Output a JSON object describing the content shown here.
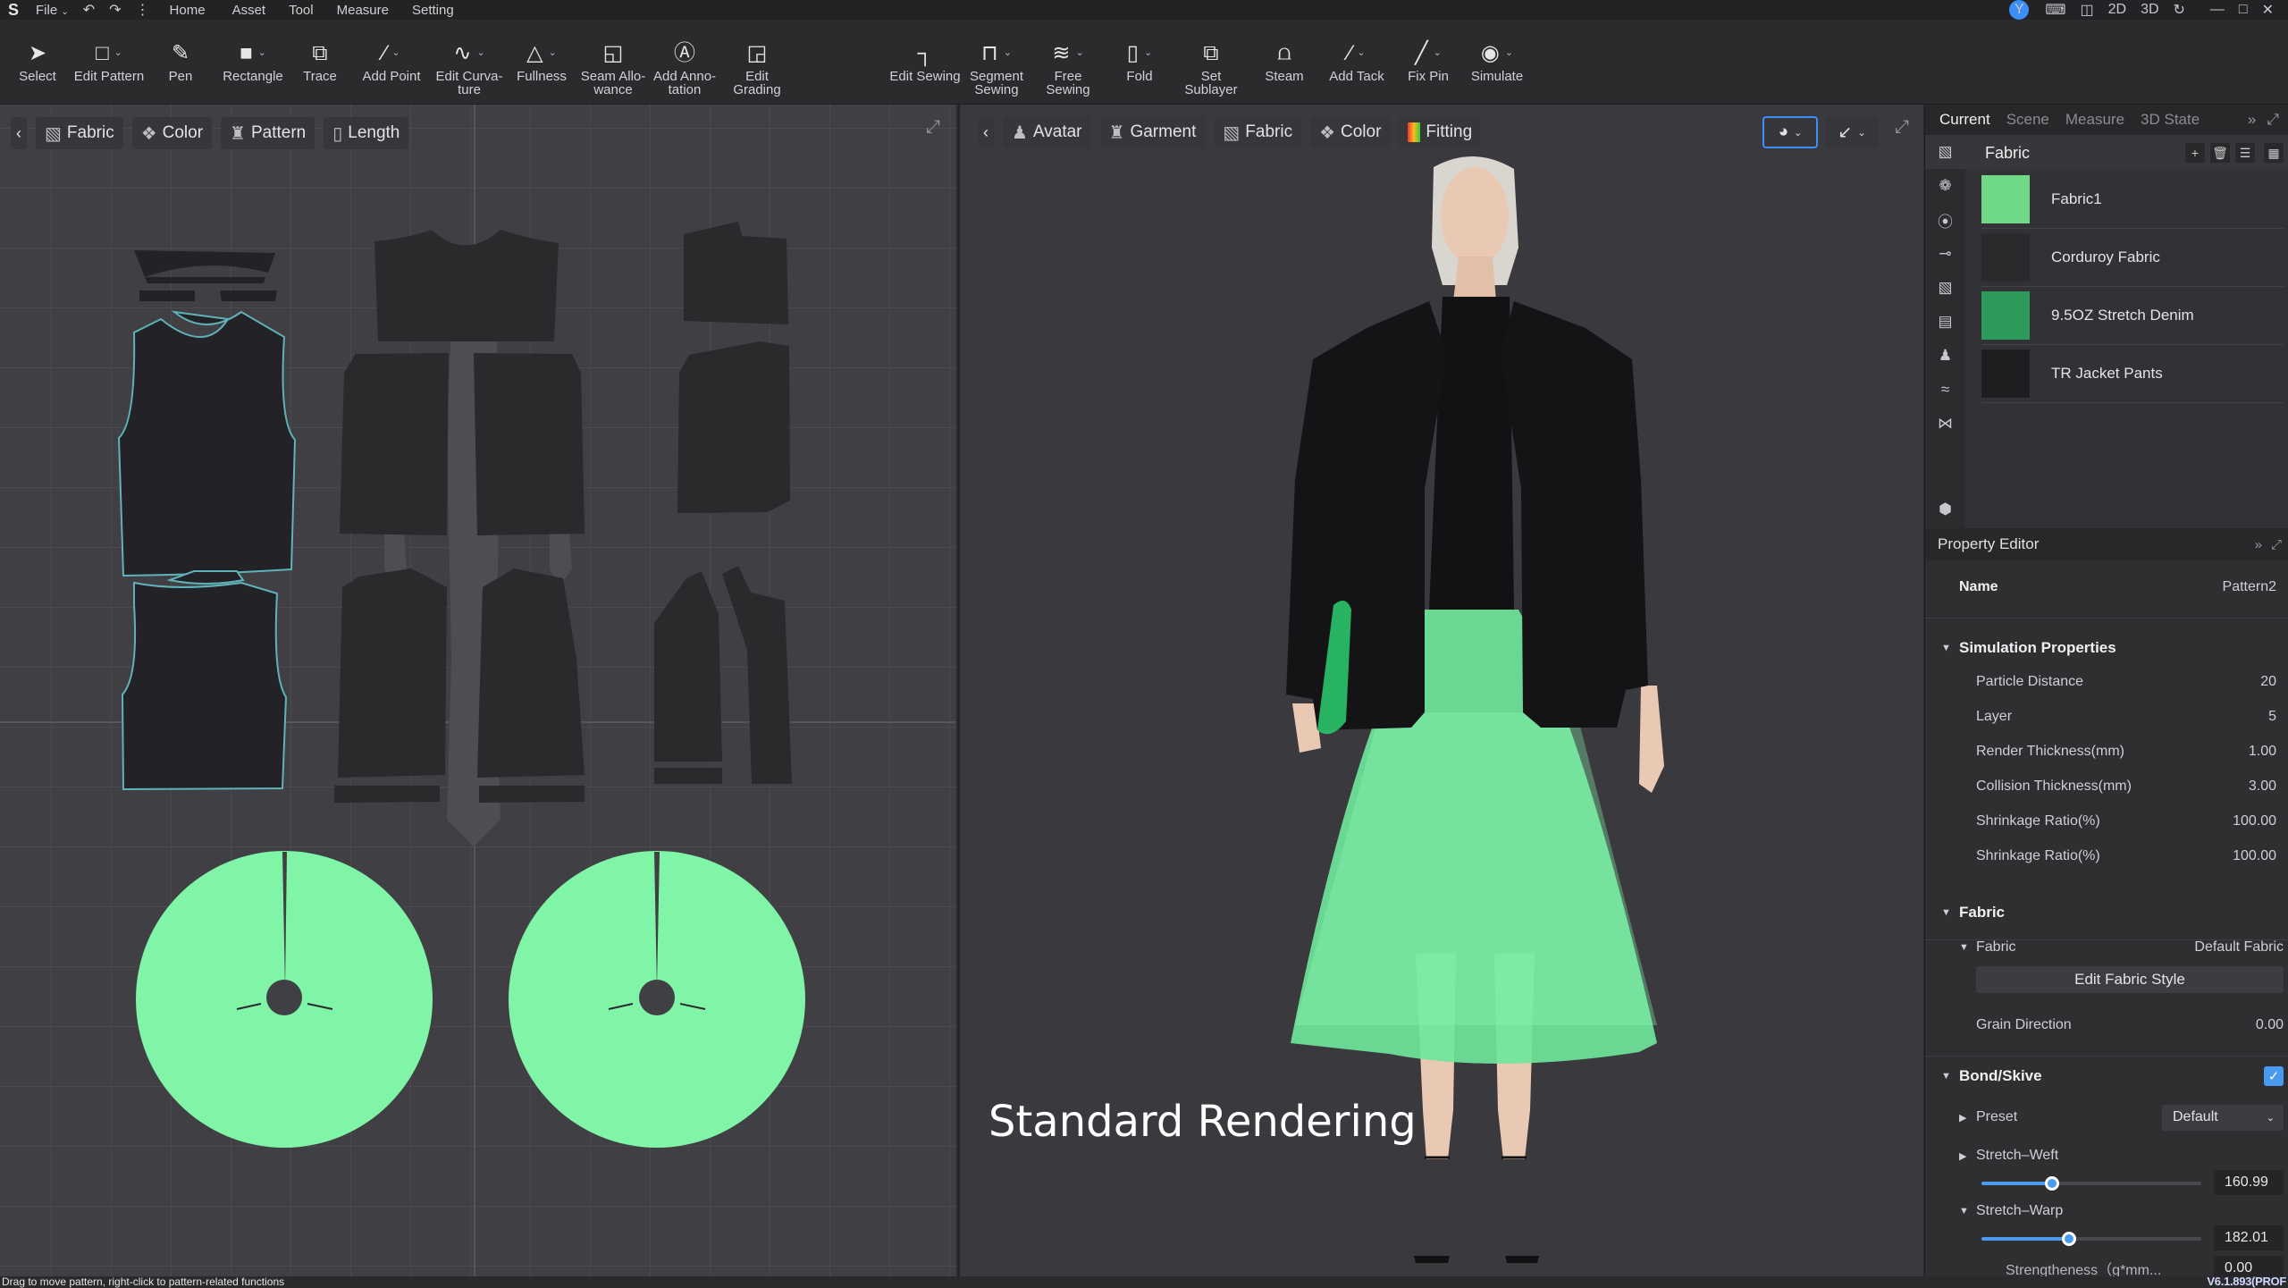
{
  "menubar": {
    "app_logo": "S",
    "file": "File",
    "undo_icon": "undo-icon",
    "redo_icon": "redo-icon",
    "more_icon": "more-vertical-icon",
    "items": [
      "Home",
      "Asset",
      "Tool",
      "Measure",
      "Setting"
    ],
    "user_initial": "Y",
    "view_modes": [
      "2D",
      "3D"
    ],
    "right_icons": [
      "keyboard-icon",
      "split-view-icon",
      "refresh-icon",
      "minimize-icon",
      "maximize-icon",
      "close-icon"
    ]
  },
  "toolbar": {
    "tools_2d": [
      {
        "label": "Select",
        "icon": "select-arrow-icon",
        "dropdown": false
      },
      {
        "label": "Edit Pattern",
        "icon": "edit-pattern-icon",
        "dropdown": true
      },
      {
        "label": "Pen",
        "icon": "pen-icon",
        "dropdown": false
      },
      {
        "label": "Rectangle",
        "icon": "rectangle-icon",
        "dropdown": true
      },
      {
        "label": "Trace",
        "icon": "trace-icon",
        "dropdown": false
      },
      {
        "label": "Add Point",
        "icon": "add-point-icon",
        "dropdown": true
      },
      {
        "label": "Edit Curva-\nture",
        "icon": "edit-curvature-icon",
        "dropdown": true
      },
      {
        "label": "Fullness",
        "icon": "fullness-icon",
        "dropdown": true
      },
      {
        "label": "Seam Allo-\nwance",
        "icon": "seam-allowance-icon",
        "dropdown": false
      },
      {
        "label": "Add Anno-\ntation",
        "icon": "annotation-icon",
        "dropdown": false
      },
      {
        "label": "Edit Grading",
        "icon": "edit-grading-icon",
        "dropdown": false
      }
    ],
    "tools_3d": [
      {
        "label": "Edit Sewing",
        "icon": "edit-sewing-icon",
        "dropdown": false
      },
      {
        "label": "Segment\nSewing",
        "icon": "segment-sewing-icon",
        "dropdown": true
      },
      {
        "label": "Free Sewing",
        "icon": "free-sewing-icon",
        "dropdown": true
      },
      {
        "label": "Fold",
        "icon": "fold-icon",
        "dropdown": true
      },
      {
        "label": "Set Sublayer",
        "icon": "set-sublayer-icon",
        "dropdown": false
      },
      {
        "label": "Steam",
        "icon": "steam-iron-icon",
        "dropdown": false
      },
      {
        "label": "Add Tack",
        "icon": "add-tack-icon",
        "dropdown": true
      },
      {
        "label": "Fix Pin",
        "icon": "fix-pin-icon",
        "dropdown": true
      },
      {
        "label": "Simulate",
        "icon": "simulate-icon",
        "dropdown": true
      }
    ]
  },
  "panel2d": {
    "filters": [
      "Fabric",
      "Color",
      "Pattern",
      "Length"
    ],
    "pattern_colors": {
      "dark": "#232226",
      "jacket": "#2a292c",
      "skirt": "#80f5a8",
      "outline": "#5fb3b8"
    }
  },
  "panel3d": {
    "filters": [
      "Avatar",
      "Garment",
      "Fabric",
      "Color",
      "Fitting"
    ],
    "overlay_label": "Standard Rendering",
    "colors": {
      "skirt": "#6fe69a",
      "jacket": "#141315",
      "skin": "#e9c9b4",
      "hair": "#d8d6cf"
    }
  },
  "rightpanel": {
    "tabs": [
      "Current",
      "Scene",
      "Measure",
      "3D State"
    ],
    "active_tab": "Current",
    "object_browser": {
      "title": "Fabric",
      "fabrics": [
        {
          "name": "Fabric1",
          "color": "#6fd987"
        },
        {
          "name": "Corduroy Fabric",
          "color": "#2a292c"
        },
        {
          "name": "9.5OZ Stretch Denim",
          "color": "#2e9a5c"
        },
        {
          "name": "TR Jacket Pants",
          "color": "#1e1d20"
        }
      ]
    },
    "property_editor": {
      "title": "Property Editor",
      "name_label": "Name",
      "name_value": "Pattern2",
      "simulation": {
        "title": "Simulation Properties",
        "rows": [
          {
            "label": "Particle Distance",
            "value": "20"
          },
          {
            "label": "Layer",
            "value": "5"
          },
          {
            "label": "Render Thickness(mm)",
            "value": "1.00"
          },
          {
            "label": "Collision Thickness(mm)",
            "value": "3.00"
          },
          {
            "label": "Shrinkage Ratio(%)",
            "value": "100.00"
          },
          {
            "label": "Shrinkage Ratio(%)",
            "value": "100.00"
          }
        ]
      },
      "fabric": {
        "title": "Fabric",
        "sub_label": "Fabric",
        "sub_value": "Default Fabric",
        "edit_button": "Edit  Fabric Style",
        "grain_label": "Grain Direction",
        "grain_value": "0.00"
      },
      "bond": {
        "title": "Bond/Skive",
        "checked": true,
        "preset_label": "Preset",
        "preset_value": "Default",
        "weft_label": "Stretch–Weft",
        "weft_value": "160.99",
        "weft_fraction": 0.32,
        "warp_label": "Stretch–Warp",
        "warp_value": "182.01",
        "warp_fraction": 0.4,
        "strength_label": "Strengtheness（g*mm...",
        "strength_value": "0.00"
      }
    }
  },
  "statusbar": {
    "hint": "Drag to move pattern, right-click to pattern-related functions",
    "version": "V6.1.893(PROF"
  }
}
